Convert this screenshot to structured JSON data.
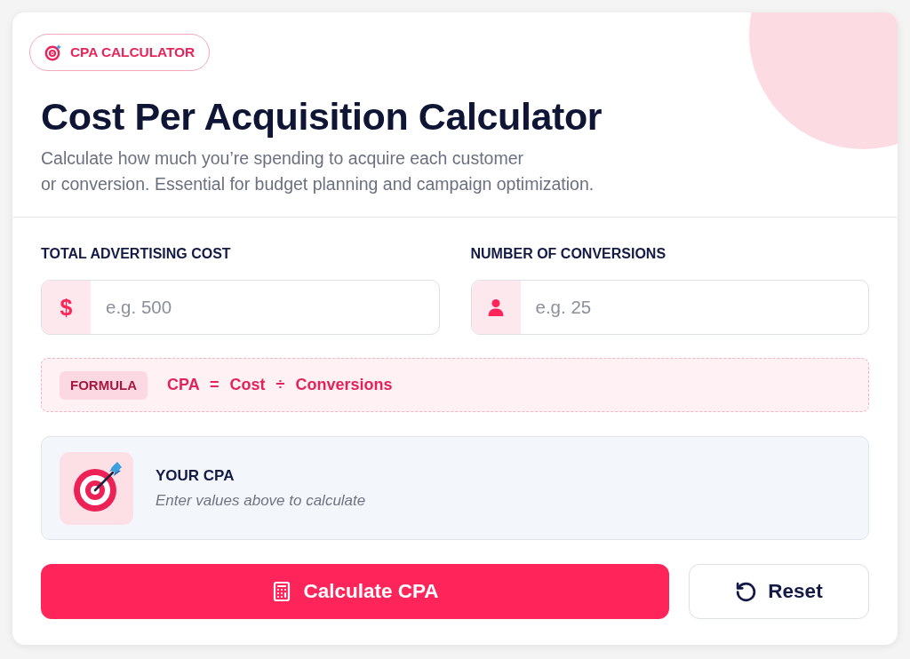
{
  "badge": {
    "label": "CPA CALCULATOR"
  },
  "title": "Cost Per Acquisition Calculator",
  "description": "Calculate how much you’re spending to acquire each customer\nor conversion. Essential for budget planning and campaign optimization.",
  "fields": [
    {
      "kind": "currency",
      "label": "TOTAL ADVERTISING COST",
      "prefix": "$",
      "placeholder": "e.g. 500"
    },
    {
      "kind": "count",
      "label": "NUMBER OF CONVERSIONS",
      "placeholder": "e.g. 25"
    }
  ],
  "formula": {
    "tag": "FORMULA",
    "expression": "CPA = Cost ÷ Conversions"
  },
  "result": {
    "title": "YOUR CPA",
    "hint": "Enter values above to calculate"
  },
  "buttons": [
    {
      "kind": "primary",
      "label": "Calculate CPA"
    },
    {
      "kind": "secondary",
      "label": "Reset"
    }
  ]
}
